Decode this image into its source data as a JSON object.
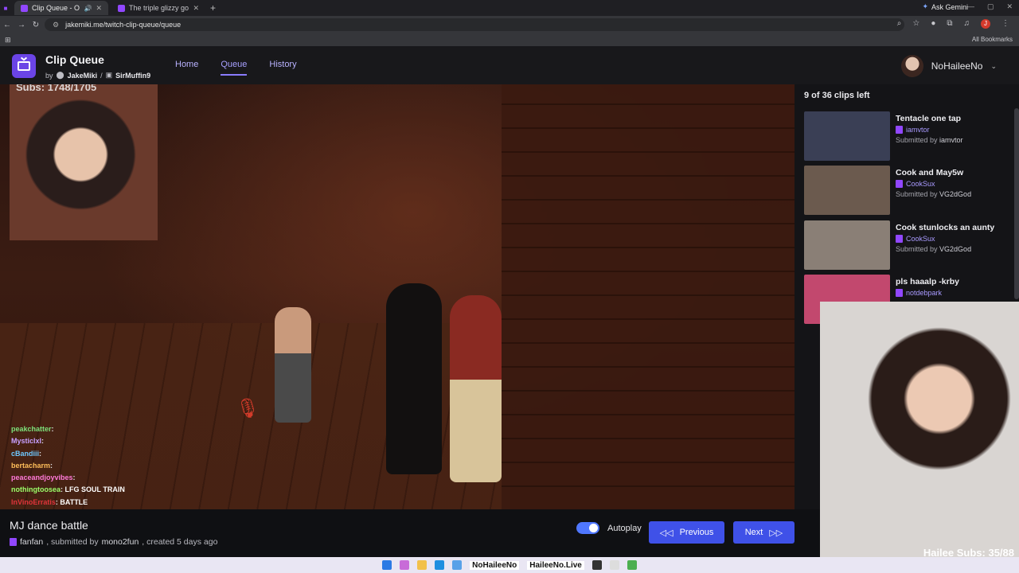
{
  "browser": {
    "tabs": [
      {
        "title": "Clip Queue - Open",
        "active": true
      },
      {
        "title": "The triple glizzy gobbler - Twit",
        "active": false
      }
    ],
    "gemini_label": "Ask Gemini",
    "url": "jakemiki.me/twitch-clip-queue/queue",
    "all_bookmarks": "All Bookmarks",
    "profile_initial": "J"
  },
  "app": {
    "title": "Clip Queue",
    "by": "by",
    "author1": "JakeMiki",
    "separator": "/",
    "author2": "SirMuffin9",
    "nav": [
      "Home",
      "Queue",
      "History"
    ],
    "username": "NoHaileeNo"
  },
  "player": {
    "cam_overlay_text": "Subs: 1748/1705",
    "chat": [
      {
        "user": "peakchatter",
        "msg": "",
        "color": "#7de07a"
      },
      {
        "user": "Mysticlxl",
        "msg": "",
        "color": "#c7a0ff"
      },
      {
        "user": "cBandiii",
        "msg": "",
        "color": "#6ec8ff"
      },
      {
        "user": "bertacharm",
        "msg": "",
        "color": "#ffbe5a"
      },
      {
        "user": "peaceandjoyvibes",
        "msg": "",
        "color": "#ff79d8"
      },
      {
        "user": "nothingtoosea",
        "msg": "LFG SOUL TRAIN",
        "color": "#9cff6a"
      },
      {
        "user": "InVinoErratis",
        "msg": "BATTLE",
        "color": "#e0343a"
      }
    ]
  },
  "clip": {
    "title": "MJ dance battle",
    "channel": "fanfan",
    "submitted_by_text": ", submitted by",
    "submitter": "mono2fun",
    "created_text": ", created 5 days ago"
  },
  "controls": {
    "autoplay_label": "Autoplay",
    "autoplay_on": true,
    "previous_label": "Previous",
    "next_label": "Next"
  },
  "queue": {
    "count_text": "9 of 36 clips left",
    "items": [
      {
        "title": "Tentacle one tap",
        "channel": "iamvtor",
        "submitted_prefix": "Submitted by",
        "submitter": "iamvtor",
        "thumb": "#3a3f55"
      },
      {
        "title": "Cook and May5w",
        "channel": "CookSux",
        "submitted_prefix": "Submitted by",
        "submitter": "VG2dGod",
        "thumb": "#6b5a4e"
      },
      {
        "title": "Cook stunlocks an aunty",
        "channel": "CookSux",
        "submitted_prefix": "Submitted by",
        "submitter": "VG2dGod",
        "thumb": "#8a7f76"
      },
      {
        "title": "pls haaalp -krby",
        "channel": "notdebpark",
        "submitted_prefix": "",
        "submitter": "",
        "thumb": "#c2486e"
      }
    ]
  },
  "facecam": {
    "overlay_text": "Hailee Subs: 35/88"
  },
  "taskbar": {
    "handle1": "NoHaileeNo",
    "handle2": "HaileeNo.Live"
  }
}
